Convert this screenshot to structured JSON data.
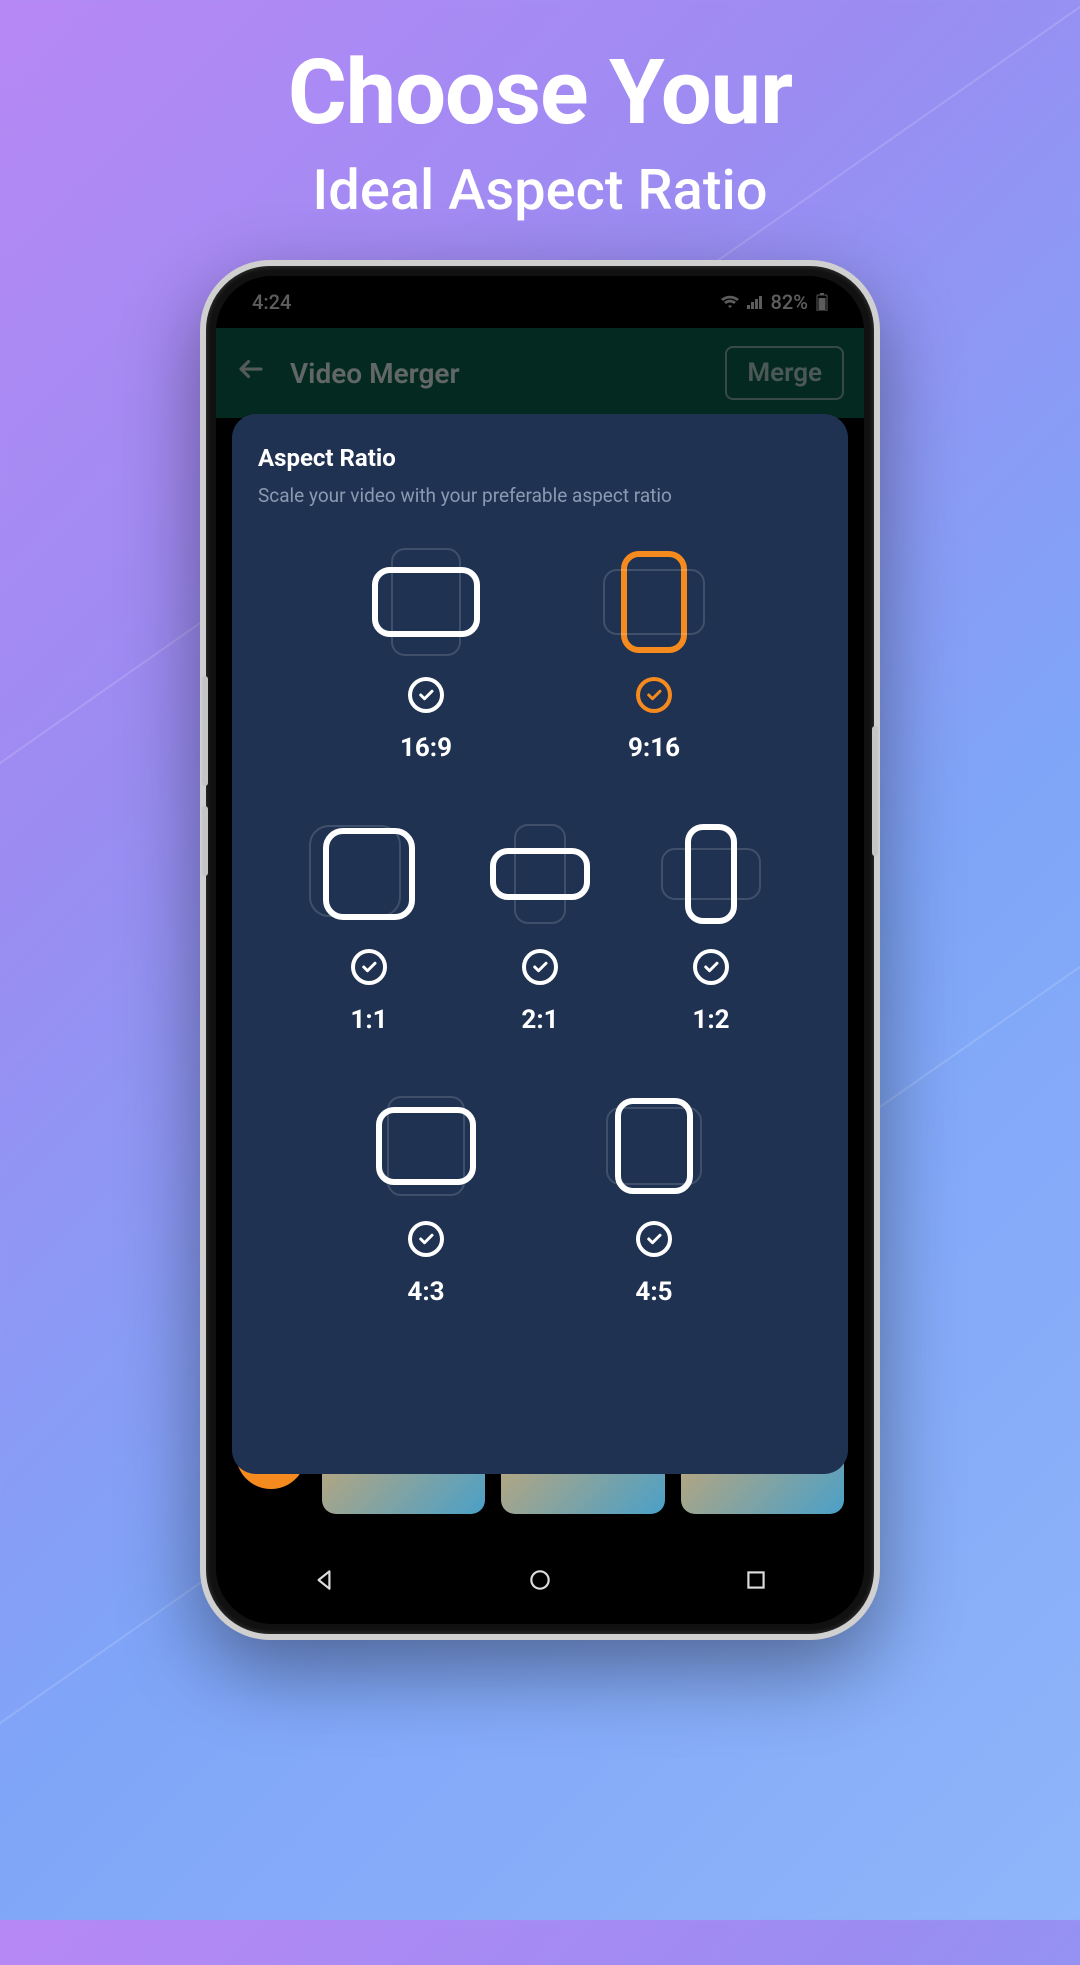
{
  "promo": {
    "headline": "Choose Your",
    "subhead": "Ideal Aspect Ratio"
  },
  "status_bar": {
    "time": "4:24",
    "wifi_icon": "wifi",
    "signal_icon": "signal",
    "battery_pct": "82%",
    "battery_icon": "battery"
  },
  "header": {
    "back_icon": "arrow-left",
    "title": "Video Merger",
    "merge_button": "Merge"
  },
  "modal": {
    "title": "Aspect Ratio",
    "subtitle": "Scale your video with your preferable aspect ratio",
    "selected": "9:16",
    "options": [
      {
        "label": "16:9",
        "shape_class": "s-16-9",
        "selected": false
      },
      {
        "label": "9:16",
        "shape_class": "s-9-16",
        "selected": true
      },
      {
        "label": "1:1",
        "shape_class": "s-1-1",
        "selected": false
      },
      {
        "label": "2:1",
        "shape_class": "s-2-1",
        "selected": false
      },
      {
        "label": "1:2",
        "shape_class": "s-1-2",
        "selected": false
      },
      {
        "label": "4:3",
        "shape_class": "s-4-3",
        "selected": false
      },
      {
        "label": "4:5",
        "shape_class": "s-4-5",
        "selected": false
      }
    ]
  },
  "navbar": {
    "back_icon": "triangle-left",
    "home_icon": "circle",
    "recent_icon": "square"
  },
  "colors": {
    "accent": "#f58a1f",
    "panel": "#1f3251",
    "app_bar": "#0b5c4a"
  }
}
